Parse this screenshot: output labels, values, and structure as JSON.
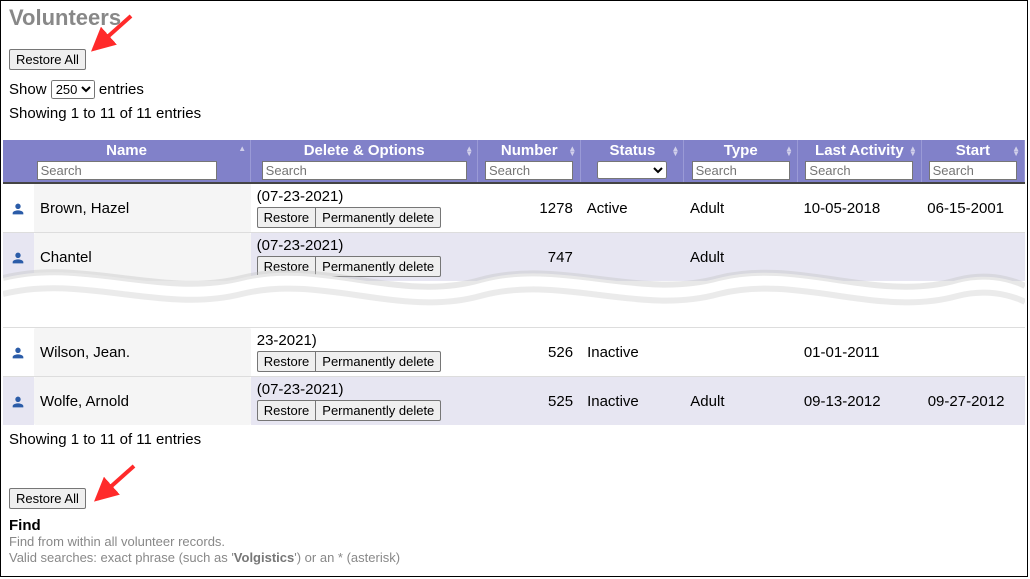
{
  "page_title": "Volunteers",
  "restore_all_label": "Restore All",
  "show_label_pre": "Show",
  "show_label_post": "entries",
  "show_value": "250",
  "info_text": "Showing 1 to 11 of 11 entries",
  "columns": {
    "name": {
      "label": "Name",
      "placeholder": "Search"
    },
    "del": {
      "label": "Delete & Options",
      "placeholder": "Search"
    },
    "num": {
      "label": "Number",
      "placeholder": "Search"
    },
    "stat": {
      "label": "Status",
      "placeholder": ""
    },
    "type": {
      "label": "Type",
      "placeholder": "Search"
    },
    "last": {
      "label": "Last Activity",
      "placeholder": "Search"
    },
    "start": {
      "label": "Start",
      "placeholder": "Search"
    }
  },
  "row_buttons": {
    "restore": "Restore",
    "perm": "Permanently delete"
  },
  "rows_top": [
    {
      "name": "Brown, Hazel",
      "date": "(07-23-2021)",
      "num": "1278",
      "status": "Active",
      "type": "Adult",
      "last": "10-05-2018",
      "start": "06-15-2001"
    },
    {
      "name": "Chantel",
      "date": "(07-23-2021)",
      "num": "747",
      "status": "",
      "type": "Adult",
      "last": "",
      "start": ""
    }
  ],
  "rows_bot": [
    {
      "name": "Wilson, Jean.",
      "date": "23-2021)",
      "num": "526",
      "status": "Inactive",
      "type": "",
      "last": "01-01-2011",
      "start": ""
    },
    {
      "name": "Wolfe, Arnold",
      "date": "(07-23-2021)",
      "num": "525",
      "status": "Inactive",
      "type": "Adult",
      "last": "09-13-2012",
      "start": "09-27-2012"
    }
  ],
  "info_text2": "Showing 1 to 11 of 11 entries",
  "find": {
    "title": "Find",
    "sub1": "Find from within all volunteer records.",
    "sub2_pre": "Valid searches: exact phrase (such as '",
    "sub2_bold": "Volgistics",
    "sub2_post": "') or an * (asterisk)"
  }
}
